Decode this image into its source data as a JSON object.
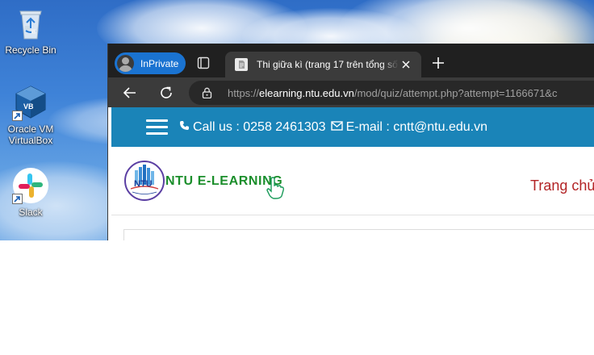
{
  "desktop": {
    "icons": [
      {
        "label": "Recycle Bin",
        "icon": "recycle-bin-icon"
      },
      {
        "label": "Oracle VM VirtualBox",
        "icon": "virtualbox-icon"
      },
      {
        "label": "Slack",
        "icon": "slack-icon"
      }
    ]
  },
  "browser": {
    "profile_label": "InPrivate",
    "tab_title": "Thi giữa kì (trang 17 trên tổng số",
    "url_scheme": "https://",
    "url_host": "elearning.ntu.edu.vn",
    "url_path": "/mod/quiz/attempt.php?attempt=1166671&c",
    "icons": [
      "tab-actions-icon",
      "new-tab-icon",
      "back-icon",
      "refresh-icon",
      "lock-icon",
      "close-icon"
    ]
  },
  "site": {
    "phone_text": "Call us : 0258 2461303",
    "email_text": "E-mail : cntt@ntu.edu.vn",
    "logo_text": "NTU E-LEARNING",
    "logo_badge": "NTU",
    "nav_home": "Trang chủ"
  },
  "colors": {
    "infobar": "#1a84b8",
    "profile_pill": "#1a73d1",
    "logo_green": "#1b8e2b",
    "nav_red": "#b32426"
  }
}
